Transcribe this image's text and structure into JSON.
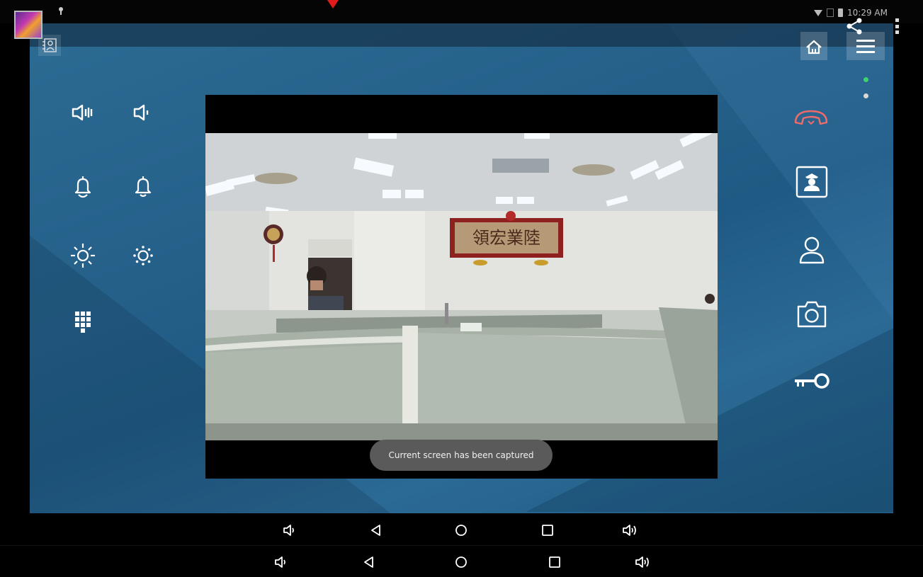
{
  "status_bar": {
    "time": "10:29 AM"
  },
  "video": {
    "toast": "Current screen has been captured",
    "sign_text": "領宏業陸"
  },
  "icons": {
    "left_controls": [
      "volume-up-icon",
      "volume-down-icon",
      "ringer-up-icon",
      "ringer-down-icon",
      "brightness-up-icon",
      "brightness-down-icon",
      "keypad-icon"
    ],
    "right_controls": [
      "hang-up-icon",
      "guard-icon",
      "contact-icon",
      "camera-icon",
      "unlock-key-icon"
    ],
    "top_right": [
      "home-icon",
      "menu-icon",
      "share-icon",
      "more-icon"
    ],
    "navbar": [
      "volume-down-icon",
      "back-icon",
      "home-icon",
      "recents-icon",
      "volume-up-icon"
    ]
  },
  "colors": {
    "hangup": "#f26b6b",
    "page_dot_active": "#3fd46b",
    "background": "#245f88"
  }
}
